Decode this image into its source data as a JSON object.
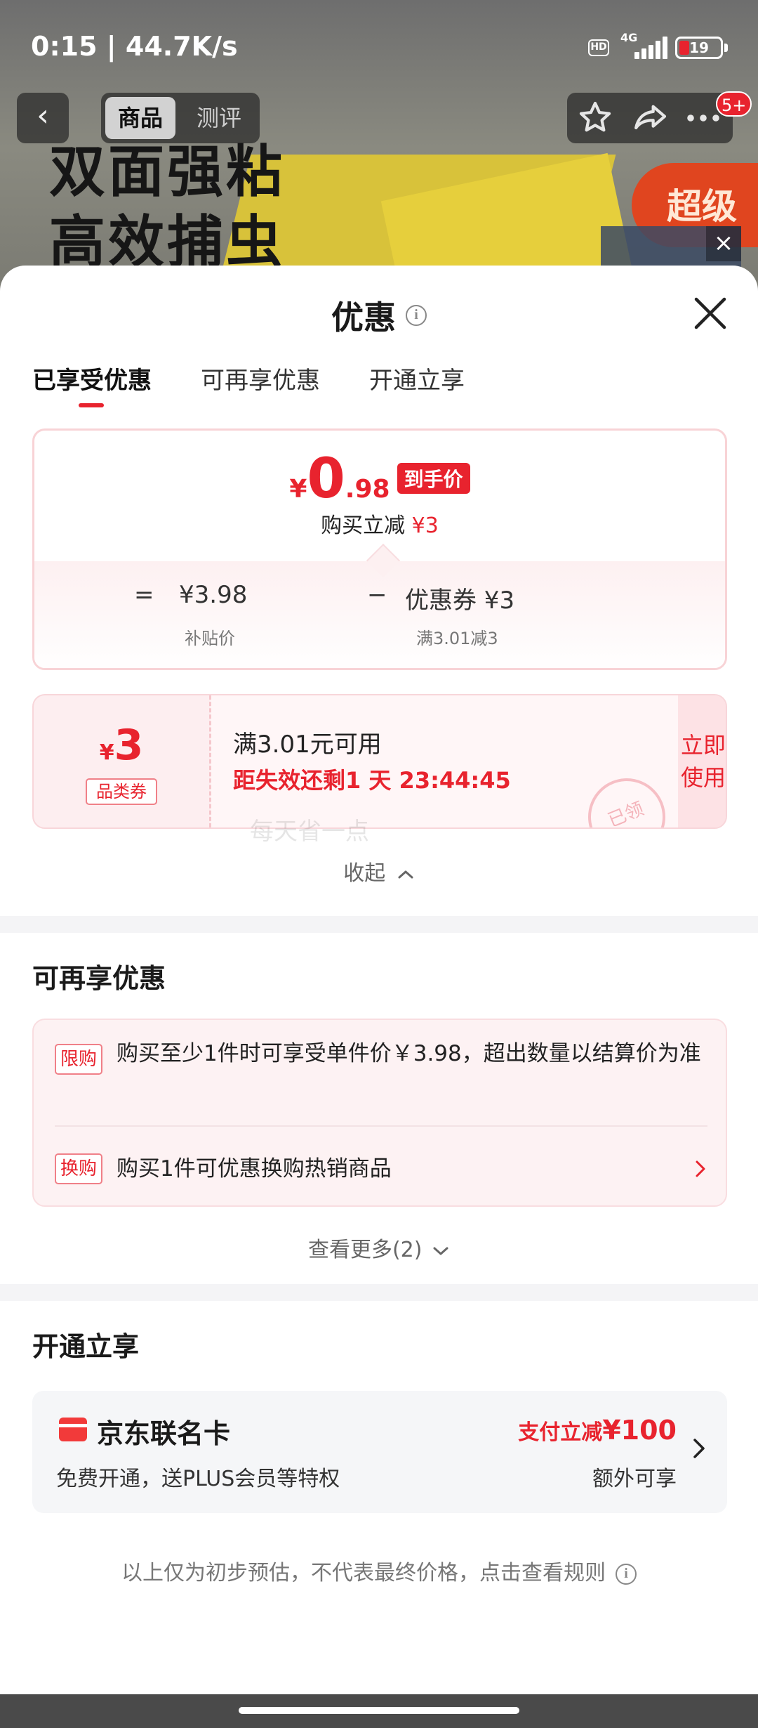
{
  "status_bar": {
    "time": "0:15",
    "speed": "44.7K/s",
    "hd": "HD",
    "network": "4G",
    "battery": "19"
  },
  "background": {
    "headline_line1": "双面强粘",
    "headline_line2": "高效捕虫",
    "promo_badge": "超级",
    "close_glyph": "×"
  },
  "top_nav": {
    "back_glyph": "‹",
    "tabs": [
      {
        "label": "商品",
        "active": true
      },
      {
        "label": "测评",
        "active": false
      }
    ],
    "badge": "5+"
  },
  "sheet": {
    "title": "优惠",
    "info_glyph": "i",
    "tabs": [
      {
        "label": "已享受优惠",
        "active": true
      },
      {
        "label": "可再享优惠",
        "active": false
      },
      {
        "label": "开通立享",
        "active": false
      }
    ],
    "price": {
      "currency": "¥",
      "integer": "0",
      "decimal": ".98",
      "tag": "到手价",
      "sub_label": "购买立减",
      "sub_value": "¥3",
      "eq": "=",
      "base_price": "¥3.98",
      "minus": "−",
      "coupon_label": "优惠券 ¥3",
      "base_caption": "补贴价",
      "coupon_caption": "满3.01减3"
    },
    "coupon": {
      "currency": "¥",
      "amount": "3",
      "type": "品类券",
      "condition": "满3.01元可用",
      "expiry": "距失效还剩1 天 23:44:45",
      "use_line1": "立即",
      "use_line2": "使用",
      "stamp": "已领",
      "watermark": "每天省一点"
    },
    "collapse_label": "收起",
    "more_offers": {
      "title": "可再享优惠",
      "items": [
        {
          "tag": "限购",
          "text": "购买至少1件时可享受单件价￥3.98，超出数量以结算价为准"
        },
        {
          "tag": "换购",
          "text": "购买1件可优惠换购热销商品"
        }
      ],
      "see_more": "查看更多(2)"
    },
    "open_now": {
      "title": "开通立享",
      "card_name": "京东联名卡",
      "card_desc": "免费开通，送PLUS会员等特权",
      "offer_label": "支付立减",
      "offer_value": "¥100",
      "offer_extra": "额外可享"
    },
    "disclaimer": "以上仅为初步预估，不代表最终价格，点击查看规则"
  },
  "colors": {
    "accent": "#e8232e",
    "card_bg": "#f5f6f8",
    "pink_bg": "#fdf2f3"
  }
}
